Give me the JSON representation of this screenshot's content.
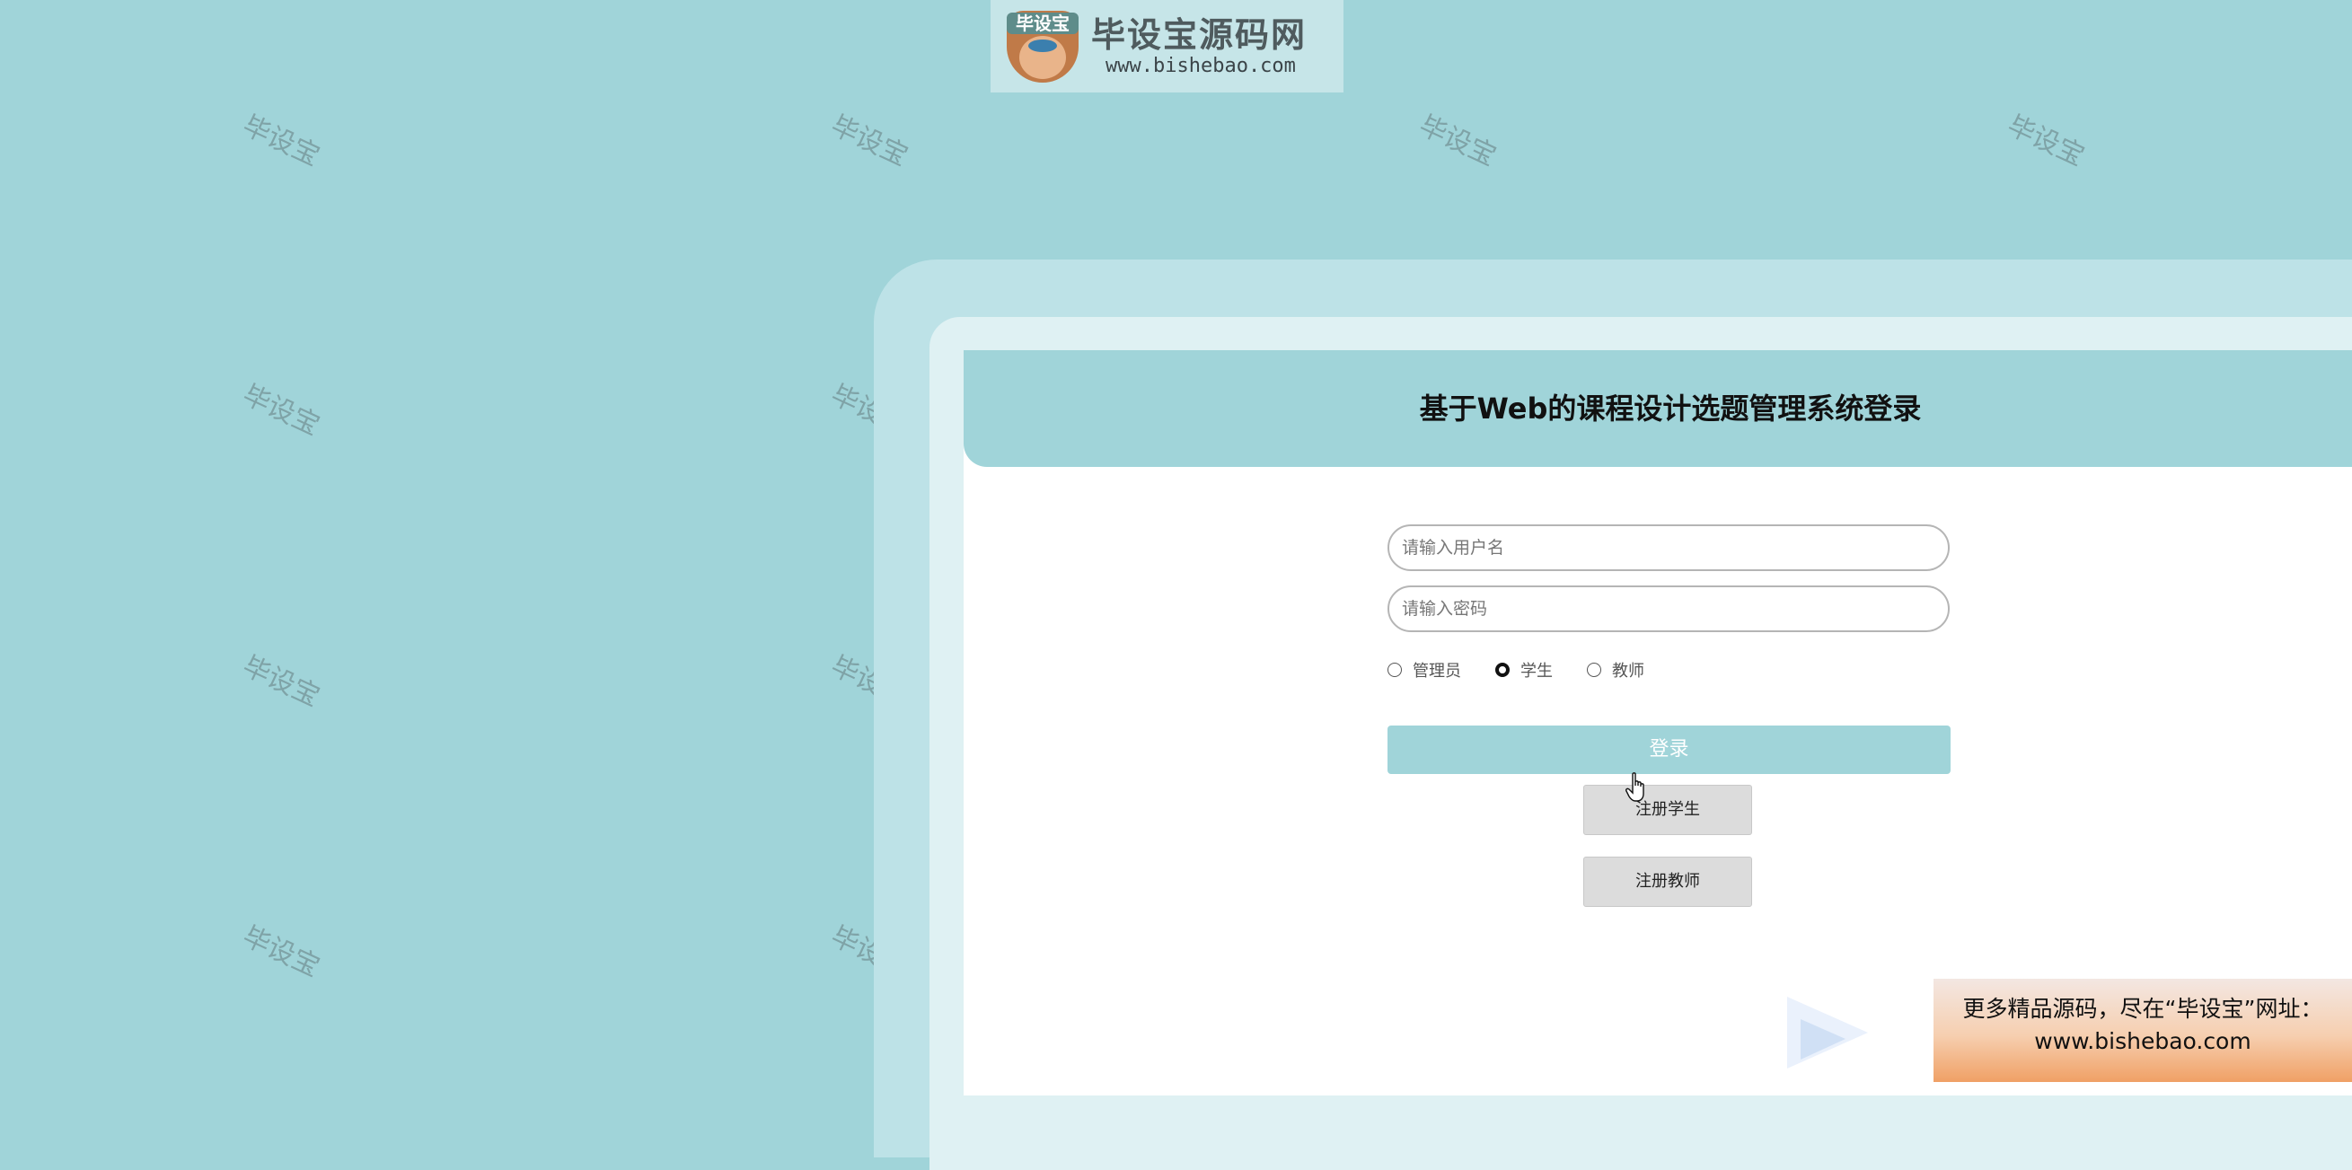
{
  "logo": {
    "badge": "毕设宝",
    "title": "毕设宝源码网",
    "url": "www.bishebao.com"
  },
  "watermark": "毕设宝",
  "login": {
    "title": "基于Web的课程设计选题管理系统登录",
    "username_placeholder": "请输入用户名",
    "password_placeholder": "请输入密码",
    "roles": [
      {
        "label": "管理员",
        "selected": false
      },
      {
        "label": "学生",
        "selected": true
      },
      {
        "label": "教师",
        "selected": false
      }
    ],
    "login_button": "登录",
    "register_student": "注册学生",
    "register_teacher": "注册教师"
  },
  "footer_ad": {
    "line1": "更多精品源码，尽在“毕设宝”网址：",
    "line2": "www.bishebao.com"
  },
  "colors": {
    "background": "#a0d4d9",
    "accent": "#a0d4d9",
    "card": "#ffffff"
  }
}
